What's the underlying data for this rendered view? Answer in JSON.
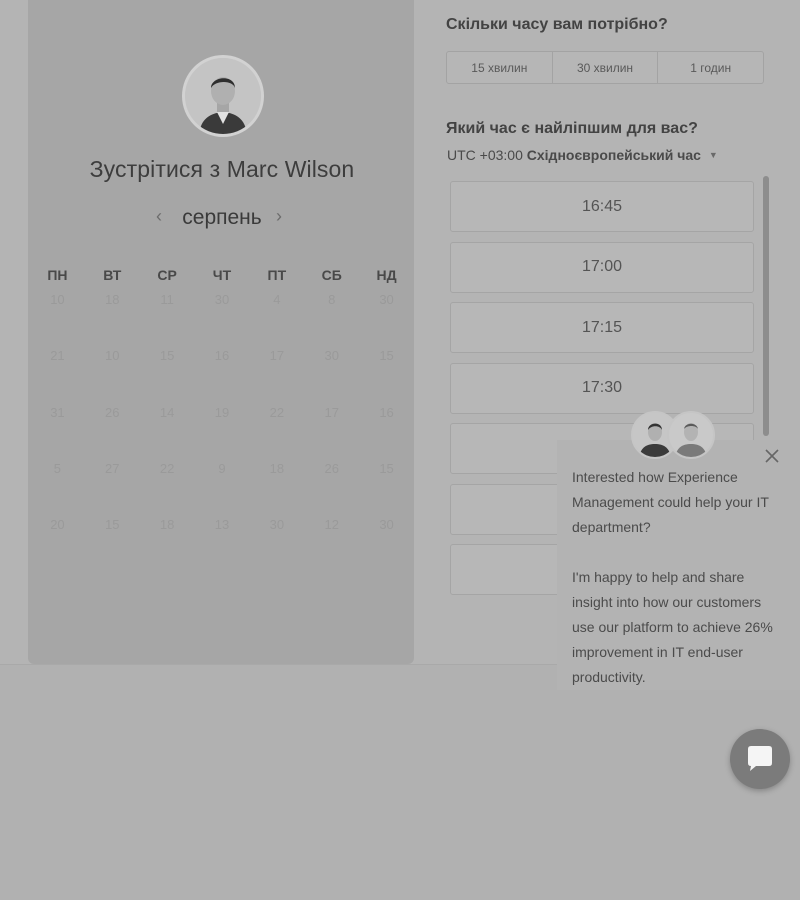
{
  "scheduler": {
    "title": "Зустрітися з Marc Wilson",
    "month": "серпень",
    "weekdays": [
      "ПН",
      "ВТ",
      "СР",
      "ЧТ",
      "ПТ",
      "СБ",
      "НД"
    ],
    "days": [
      "10",
      "18",
      "11",
      "30",
      "4",
      "8",
      "30",
      "21",
      "10",
      "15",
      "16",
      "17",
      "30",
      "15",
      "31",
      "26",
      "14",
      "19",
      "22",
      "17",
      "16",
      "5",
      "27",
      "22",
      "9",
      "18",
      "26",
      "15",
      "20",
      "15",
      "18",
      "13",
      "30",
      "12",
      "30"
    ]
  },
  "duration": {
    "title": "Скільки часу вам потрібно?",
    "options": [
      "15 хвилин",
      "30 хвилин",
      "1 годин"
    ]
  },
  "time": {
    "title": "Який час є найліпшим для вас?",
    "tz_offset": "UTC +03:00",
    "tz_name": "Східноєвропейський час",
    "slots": [
      "16:45",
      "17:00",
      "17:15",
      "17:30",
      "",
      "",
      ""
    ]
  },
  "chat": {
    "message_1": "Interested how Experience Management could help your IT department?",
    "message_2": "I'm happy to help and share insight into how our customers use our platform to achieve 26% improvement in IT end-user productivity."
  },
  "icons": {
    "prev": "chevron-left-icon",
    "next": "chevron-right-icon",
    "close": "close-icon",
    "chat": "chat-bubble-icon",
    "tz": "caret-down-icon"
  }
}
